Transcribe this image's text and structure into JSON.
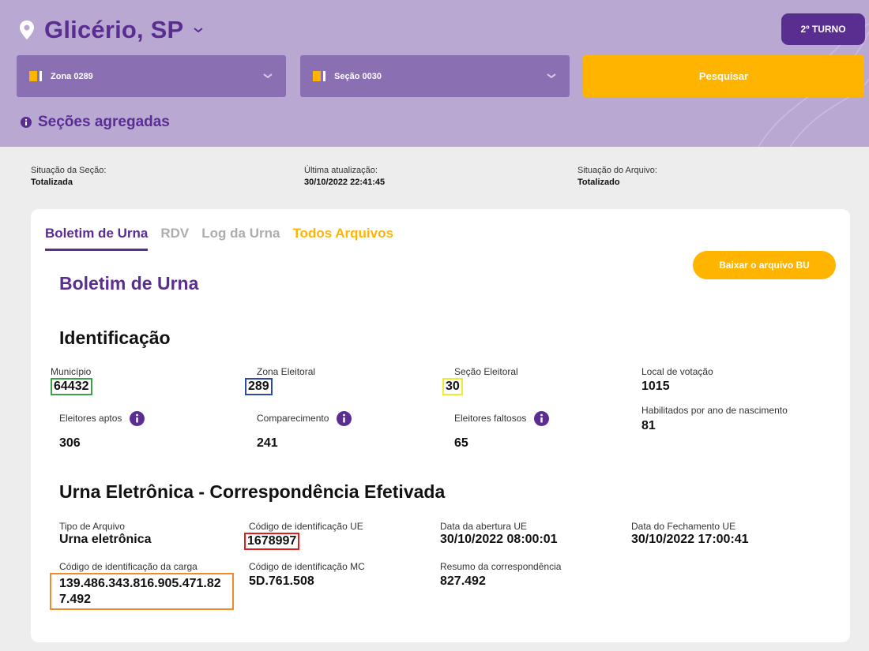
{
  "header": {
    "city": "Glicério, SP",
    "turno": "2º TURNO",
    "zona_select": "Zona 0289",
    "secao_select": "Seção 0030",
    "search_label": "Pesquisar",
    "agregadas_label": "Seções agregadas"
  },
  "status": {
    "secao_label": "Situação da Seção:",
    "secao_value": "Totalizada",
    "atualizacao_label": "Última atualização:",
    "atualizacao_value": "30/10/2022 22:41:45",
    "arquivo_label": "Situação do Arquivo:",
    "arquivo_value": "Totalizado"
  },
  "tabs": [
    {
      "label": "Boletim de Urna"
    },
    {
      "label": "RDV"
    },
    {
      "label": "Log da Urna"
    },
    {
      "label": "Todos Arquivos"
    }
  ],
  "download_label": "Baixar o arquivo BU",
  "bu_title": "Boletim de Urna",
  "identificacao": {
    "title": "Identificação",
    "municipio_label": "Município",
    "municipio_value": "64432",
    "zona_label": "Zona Eleitoral",
    "zona_value": "289",
    "secao_label": "Seção Eleitoral",
    "secao_value": "30",
    "local_label": "Local de votação",
    "local_value": "1015",
    "aptos_label": "Eleitores aptos",
    "aptos_value": "306",
    "comparecimento_label": "Comparecimento",
    "comparecimento_value": "241",
    "faltosos_label": "Eleitores faltosos",
    "faltosos_value": "65",
    "habilitados_label": "Habilitados por ano de nascimento",
    "habilitados_value": "81"
  },
  "urna": {
    "title": "Urna Eletrônica - Correspondência Efetivada",
    "tipo_label": "Tipo de Arquivo",
    "tipo_value": "Urna eletrônica",
    "codigo_ue_label": "Código de identificação UE",
    "codigo_ue_value": "1678997",
    "abertura_label": "Data da abertura UE",
    "abertura_value": "30/10/2022 08:00:01",
    "fechamento_label": "Data do Fechamento UE",
    "fechamento_value": "30/10/2022 17:00:41",
    "carga_label": "Código de identificação da carga",
    "carga_value": "139.486.343.816.905.471.827.492",
    "codigo_mc_label": "Código de identificação MC",
    "codigo_mc_value": "5D.761.508",
    "resumo_label": "Resumo da correspondência",
    "resumo_value": "827.492"
  },
  "colors": {
    "header_bg": "#b9a8d2",
    "brand_purple": "#5a2d91",
    "accent_orange": "#ffb400",
    "select_bg": "#8a6fb2"
  },
  "icons": [
    "location-pin-icon",
    "chevron-down-icon",
    "info-icon"
  ]
}
